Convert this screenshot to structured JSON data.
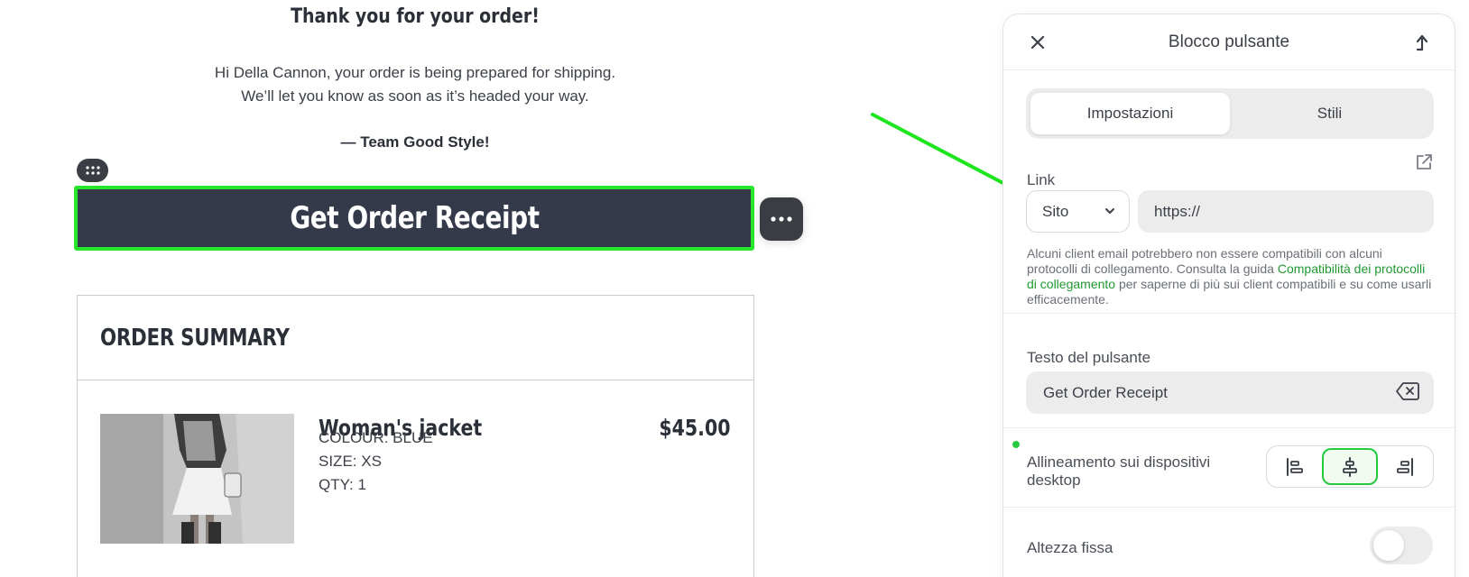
{
  "email": {
    "title": "Thank you for your order!",
    "body_line1": "Hi Della Cannon, your order is being prepared for shipping.",
    "body_line2": "We’ll let you know as soon as it’s headed your way.",
    "signature": "— Team Good Style!",
    "cta_label": "Get Order Receipt",
    "order_summary": {
      "title": "ORDER SUMMARY",
      "item": {
        "name": "Woman's jacket",
        "price": "$45.00",
        "colour": "COLOUR: BLUE",
        "size": "SIZE: XS",
        "qty": "QTY: 1"
      }
    }
  },
  "panel": {
    "title": "Blocco pulsante",
    "tabs": [
      {
        "label": "Impostazioni",
        "active": true
      },
      {
        "label": "Stili",
        "active": false
      }
    ],
    "link": {
      "label": "Link",
      "type_selected": "Sito",
      "url_value": "https://"
    },
    "help": {
      "prefix": "Alcuni client email potrebbero non essere compatibili con alcuni protocolli di collegamento. Consulta la guida ",
      "link_text": "Compatibilità dei protocolli di collegamento",
      "suffix": " per saperne di più sui client compatibili e su come usarli efficacemente."
    },
    "button_text": {
      "label": "Testo del pulsante",
      "value": "Get Order Receipt"
    },
    "alignment": {
      "label": "Allineamento sui dispositivi desktop",
      "options": [
        "left",
        "center",
        "right"
      ],
      "selected": "center"
    },
    "fixed_height": {
      "label": "Altezza fissa",
      "enabled": false
    }
  },
  "colors": {
    "accent_green": "#27e62b",
    "button_bg": "#353a4b",
    "link_green": "#1f9a31"
  }
}
